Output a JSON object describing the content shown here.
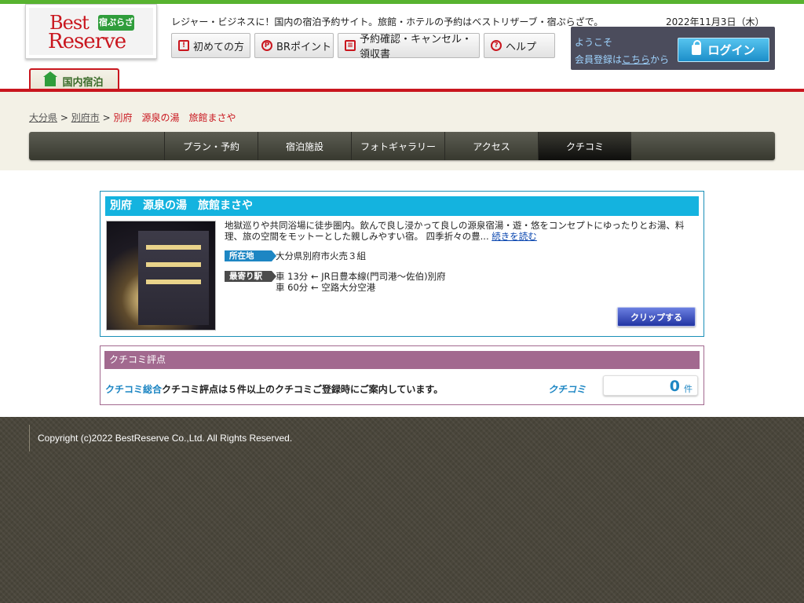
{
  "header": {
    "logo_best": "Best",
    "logo_reserve": "Reserve",
    "logo_badge": "宿ぷらざ",
    "tagline": "レジャー・ビジネスに！国内の宿泊予約サイト。旅館・ホテルの予約はベストリザーブ・宿ぷらざで。",
    "date": "2022年11月3日（木）",
    "nav": [
      {
        "label": "初めての方",
        "icon": "first-time-icon"
      },
      {
        "label": "BRポイント",
        "icon": "points-icon"
      },
      {
        "label": "予約確認・キャンセル・領収書",
        "icon": "document-icon"
      },
      {
        "label": "ヘルプ",
        "icon": "help-icon"
      }
    ],
    "login": {
      "welcome": "ようこそ",
      "member_prefix": "会員登録は",
      "member_link": "こちら",
      "member_suffix": "から",
      "button": "ログイン"
    },
    "domestic_tab": "国内宿泊"
  },
  "breadcrumb": {
    "prefecture": "大分県",
    "sep1": ">",
    "city": "別府市",
    "sep2": ">",
    "current": "別府　源泉の湯　旅館まさや"
  },
  "tabs": [
    {
      "label": "プラン・予約",
      "active": false
    },
    {
      "label": "宿泊施設",
      "active": false
    },
    {
      "label": "フォトギャラリー",
      "active": false
    },
    {
      "label": "アクセス",
      "active": false
    },
    {
      "label": "クチコミ",
      "active": true
    }
  ],
  "hotel": {
    "name": "別府　源泉の湯　旅館まさや",
    "description": "地獄巡りや共同浴場に徒歩圏内。飲んで良し浸かって良しの源泉宿湯・遊・悠をコンセプトにゆったりとお湯、料理、旅の空間をモットーとした親しみやすい宿。 四季折々の豊...",
    "read_more": "続きを読む",
    "address_label": "所在地",
    "address": "大分県別府市火売３組",
    "station_label": "最寄り駅",
    "station_lines": [
      "車 13分 ← JR日豊本線(門司港〜佐伯)別府",
      "車 60分 ← 空路大分空港"
    ],
    "clip_button": "クリップする"
  },
  "review": {
    "header": "クチコミ評点",
    "summary_label": "クチコミ総合",
    "summary_text": "クチコミ評点は５件以上のクチコミご登録時にご案内しています。",
    "logo_text": "クチコミ",
    "count": "0",
    "count_unit": "件"
  },
  "footer": {
    "copyright": "Copyright (c)2022 BestReserve Co.,Ltd. All Rights Reserved."
  },
  "colors": {
    "brand_green": "#58b330",
    "brand_red": "#c9161e",
    "title_cyan": "#14b3df",
    "review_purple": "#a2698f",
    "footer_bg": "#4a463b"
  }
}
